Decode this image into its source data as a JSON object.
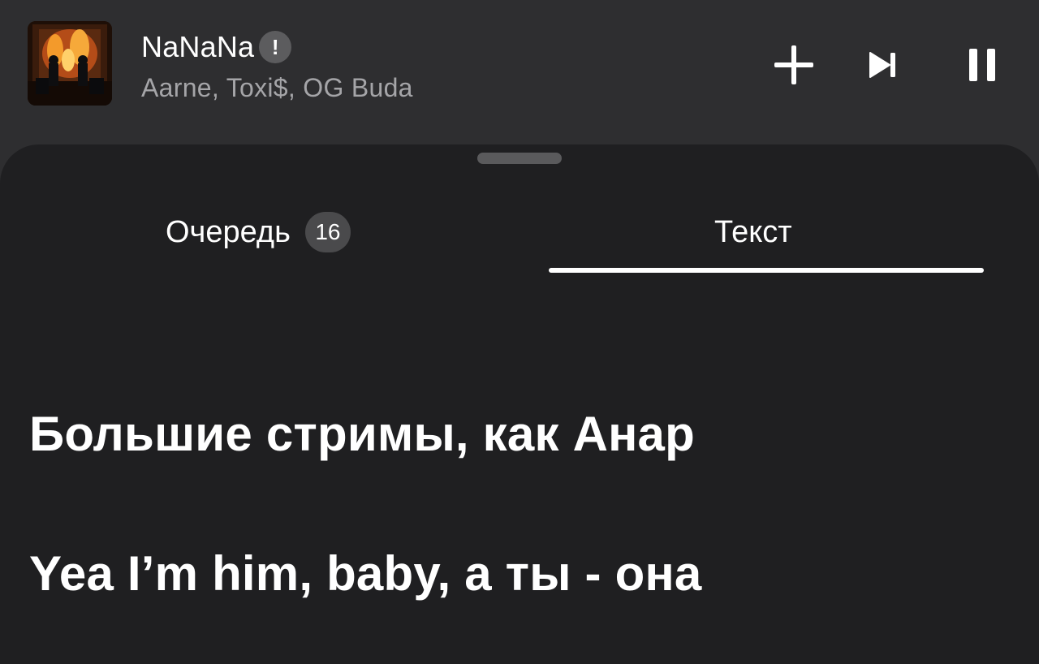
{
  "player": {
    "title": "NaNaNa",
    "explicit_badge": "!",
    "artists": "Aarne, Toxi$, OG Buda",
    "controls": {
      "add_icon": "plus-icon",
      "next_icon": "skip-next-icon",
      "pause_icon": "pause-icon"
    }
  },
  "tabs": [
    {
      "label": "Очередь",
      "badge": "16",
      "active": false
    },
    {
      "label": "Текст",
      "active": true
    }
  ],
  "lyrics": [
    "Большие стримы, как Анар",
    "Yea I’m him, baby, а ты - она"
  ],
  "colors": {
    "header_bg": "#2e2e30",
    "sheet_bg": "#1f1f21",
    "secondary_text": "#a5a5a8",
    "badge_bg": "#4a4a4c"
  }
}
